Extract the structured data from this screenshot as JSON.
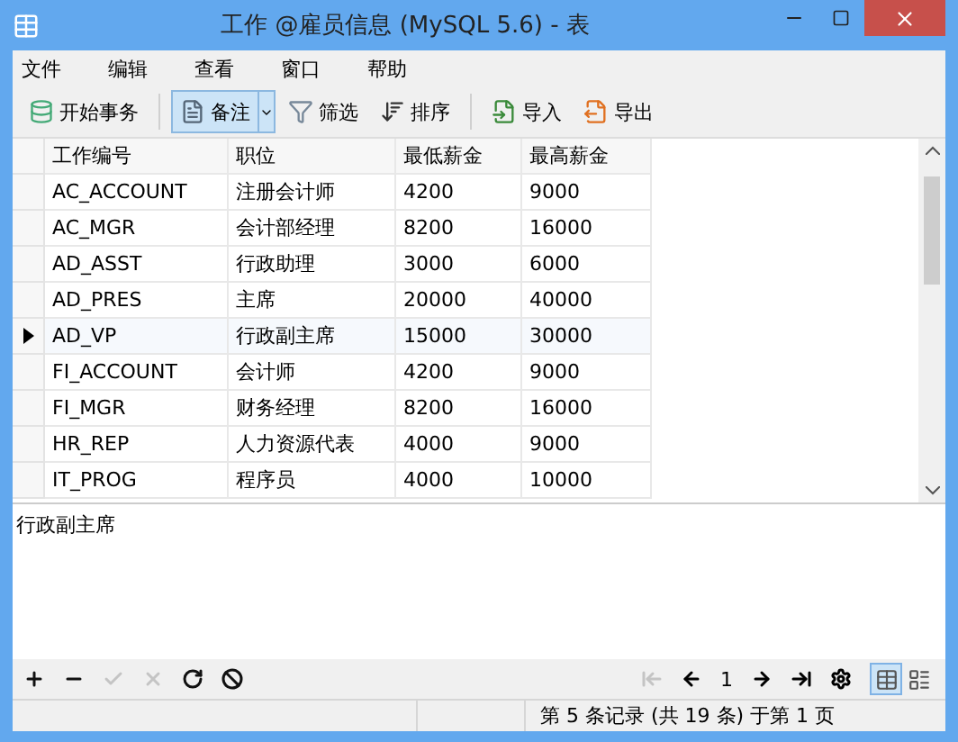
{
  "window": {
    "title": "工作 @雇员信息 (MySQL 5.6) - 表"
  },
  "menu": [
    "文件",
    "编辑",
    "查看",
    "窗口",
    "帮助"
  ],
  "toolbar": [
    {
      "kind": "button",
      "label": "开始事务",
      "selected": false
    },
    {
      "kind": "dropdown",
      "label": "备注",
      "selected": true
    },
    {
      "kind": "button",
      "label": "筛选",
      "selected": false
    },
    {
      "kind": "button",
      "label": "排序",
      "selected": false
    },
    {
      "kind": "button",
      "label": "导入",
      "selected": false
    },
    {
      "kind": "button",
      "label": "导出",
      "selected": false
    }
  ],
  "table": {
    "columns": [
      "工作编号",
      "职位",
      "最低薪金",
      "最高薪金"
    ],
    "rows": [
      {
        "cells": [
          "AC_ACCOUNT",
          "注册会计师",
          "4200",
          "9000"
        ],
        "selected": false
      },
      {
        "cells": [
          "AC_MGR",
          "会计部经理",
          "8200",
          "16000"
        ],
        "selected": false
      },
      {
        "cells": [
          "AD_ASST",
          "行政助理",
          "3000",
          "6000"
        ],
        "selected": false
      },
      {
        "cells": [
          "AD_PRES",
          "主席",
          "20000",
          "40000"
        ],
        "selected": false
      },
      {
        "cells": [
          "AD_VP",
          "行政副主席",
          "15000",
          "30000"
        ],
        "selected": true
      },
      {
        "cells": [
          "FI_ACCOUNT",
          "会计师",
          "4200",
          "9000"
        ],
        "selected": false
      },
      {
        "cells": [
          "FI_MGR",
          "财务经理",
          "8200",
          "16000"
        ],
        "selected": false
      },
      {
        "cells": [
          "HR_REP",
          "人力资源代表",
          "4000",
          "9000"
        ],
        "selected": false
      },
      {
        "cells": [
          "IT_PROG",
          "程序员",
          "4000",
          "10000"
        ],
        "selected": false
      }
    ]
  },
  "memo": {
    "value": "行政副主席"
  },
  "record_buttons": [
    {
      "disabled": false
    },
    {
      "disabled": false
    },
    {
      "disabled": true
    },
    {
      "disabled": true
    },
    {
      "disabled": false
    },
    {
      "disabled": false
    }
  ],
  "pager": {
    "first_disabled": true,
    "page": "1"
  },
  "views": [
    {
      "selected": true
    },
    {
      "selected": false
    }
  ],
  "status_bar": {
    "text": "第 5 条记录 (共 19 条) 于第 1 页"
  }
}
